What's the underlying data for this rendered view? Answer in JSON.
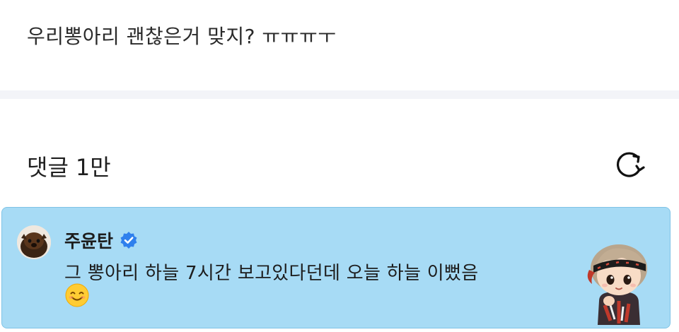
{
  "post": {
    "text": "우리뽕아리 괜찮은거 맞지? ㅠㅠㅠㅜ"
  },
  "comments_section": {
    "title": "댓글",
    "count": "1만",
    "refresh_icon": "refresh-icon"
  },
  "comment": {
    "author": "주윤탄",
    "verified_icon": "verified-badge-icon",
    "text": "그 뽕아리 하늘 7시간 보고있다던데 오늘 하늘 이뻤음",
    "emoji": "smiling-face-emoji",
    "sticker": "character-sticker",
    "highlight_color": "#a7dbf5"
  }
}
